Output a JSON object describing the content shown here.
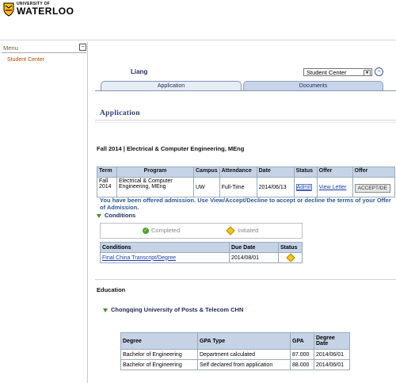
{
  "header": {
    "logo_line1": "UNIVERSITY OF",
    "logo_line2": "WATERLOO"
  },
  "menu": {
    "title": "Menu",
    "collapse": "−",
    "items": [
      "Student Center"
    ]
  },
  "topbar": {
    "username": "Liang",
    "nav_select": "Student Center",
    "go_icon": "»"
  },
  "tabs": [
    "Application",
    "Documents"
  ],
  "application": {
    "section_title": "Application",
    "program_title": "Fall 2014 | Electrical & Computer Engineering, MEng",
    "columns": [
      "Term",
      "Program",
      "Campus",
      "Attendance",
      "Date",
      "Status",
      "Offer",
      "Offer"
    ],
    "row": {
      "term": "Fall 2014",
      "program": "Electrical & Computer Engineering, MEng",
      "campus": "UW",
      "attendance": "Full-Time",
      "date": "2014/06/13",
      "status": "Admit",
      "offer_link": "View Letter",
      "offer_button": "ACCEPT/DE"
    },
    "message": "You have been offered admission. Use View/Accept/Decline to accept or decline the terms of your Offer of Admission."
  },
  "conditions": {
    "title": "Conditions",
    "legend": {
      "completed": "Completed",
      "initiated": "Initiated"
    },
    "columns": [
      "Conditions",
      "Due Date",
      "Status"
    ],
    "rows": [
      {
        "condition": "Final China Transcript/Degree",
        "due_date": "2014/08/01"
      }
    ]
  },
  "education": {
    "title": "Education",
    "institution": "Chongqing University of Posts & Telecom CHN",
    "columns": [
      "Degree",
      "GPA Type",
      "GPA",
      "Degree Date"
    ],
    "rows": [
      {
        "degree": "Bachelor of Engineering",
        "gpa_type": "Department calculated",
        "gpa": "87.000",
        "date": "2014/06/01"
      },
      {
        "degree": "Bachelor of Engineering",
        "gpa_type": "Self declared from application",
        "gpa": "88.000",
        "date": "2014/06/01"
      }
    ]
  },
  "colors": {
    "accent_blue": "#2b3f72",
    "table_header": "#c6d3e6",
    "menu_link": "#b24a00",
    "completed_green": "#4aa12e",
    "initiated_yellow": "#f3c41a"
  }
}
